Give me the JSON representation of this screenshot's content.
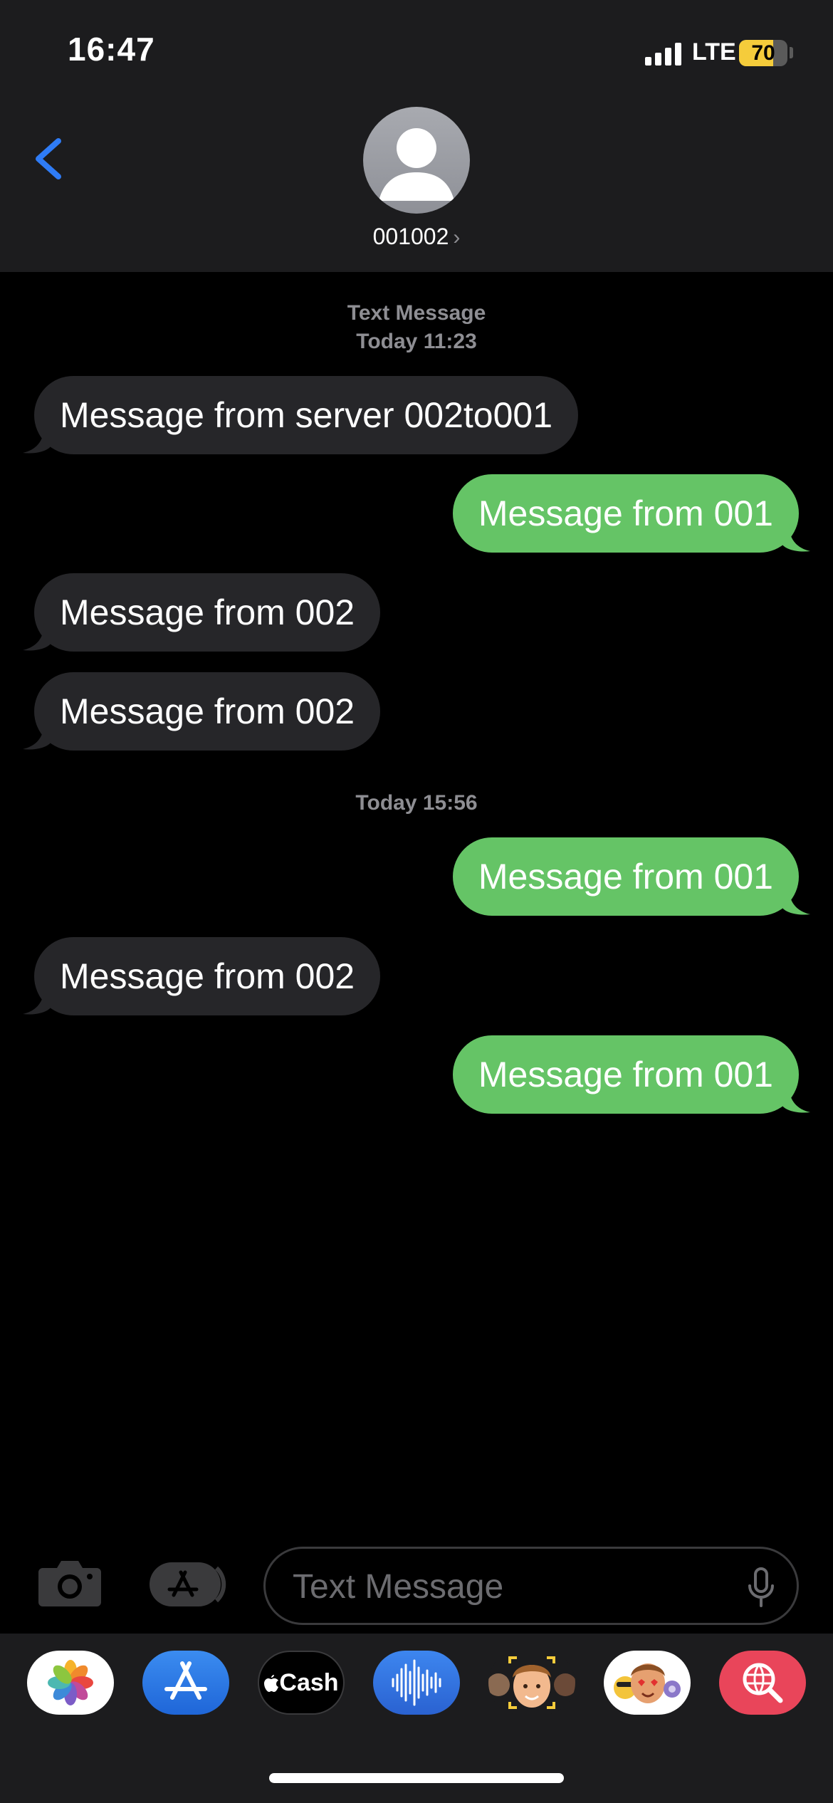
{
  "status_bar": {
    "time": "16:47",
    "network": "LTE",
    "battery_level": "70",
    "battery_fraction": 0.7,
    "signal_bars": 4
  },
  "header": {
    "back_icon": "chevron-left-icon",
    "contact": "001002",
    "contact_chevron": "›",
    "avatar_icon": "person-silhouette-icon"
  },
  "thread": {
    "service_label": "Text Message",
    "timestamp_1": "Today 11:23",
    "timestamp_2": "Today 15:56",
    "messages": [
      {
        "dir": "in",
        "text": "Message from server 002to001"
      },
      {
        "dir": "out",
        "text": "Message from 001"
      },
      {
        "dir": "in",
        "text": "Message from 002"
      },
      {
        "dir": "in",
        "text": "Message from 002"
      },
      {
        "dir": "out",
        "text": "Message from 001"
      },
      {
        "dir": "in",
        "text": "Message from 002"
      },
      {
        "dir": "out",
        "text": "Message from 001"
      }
    ]
  },
  "composer": {
    "placeholder": "Text Message",
    "camera_icon": "camera-icon",
    "apps_icon": "app-store-icon",
    "mic_icon": "microphone-icon"
  },
  "app_drawer": {
    "apps": [
      {
        "name": "Photos",
        "icon": "photos-icon"
      },
      {
        "name": "App Store",
        "icon": "app-store-icon"
      },
      {
        "name": "Cash",
        "icon": "apple-cash-icon"
      },
      {
        "name": "Audio",
        "icon": "audio-waveform-icon"
      },
      {
        "name": "Memoji",
        "icon": "memoji-icon"
      },
      {
        "name": "Memoji Stickers",
        "icon": "memoji-stickers-icon"
      },
      {
        "name": "Images",
        "icon": "image-search-icon"
      }
    ],
    "cash_label": "Cash",
    "apple_logo": ""
  },
  "colors": {
    "header_bg": "#1c1c1e",
    "incoming_bubble": "#262629",
    "outgoing_bubble": "#65c466",
    "accent_blue": "#2f7cf6",
    "battery_yellow": "#f5cc3b"
  }
}
